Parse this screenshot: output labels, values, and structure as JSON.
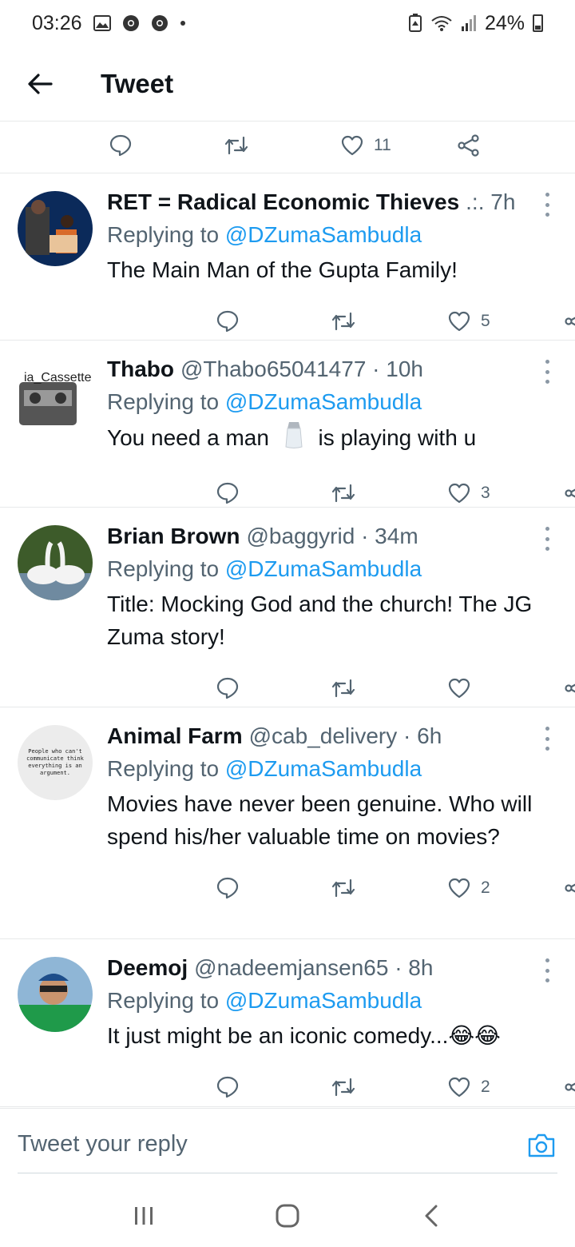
{
  "status_bar": {
    "time": "03:26",
    "battery_percent": "24%",
    "icons": [
      "gallery-icon",
      "chrome-icon",
      "chrome-icon",
      "dot-icon",
      "battery-saver-icon",
      "wifi-icon",
      "signal-icon",
      "battery-icon"
    ]
  },
  "header": {
    "title": "Tweet"
  },
  "top_actions": {
    "likes": "11"
  },
  "replying_label": "Replying to",
  "replying_handle": "@DZumaSambudla",
  "tweets": [
    {
      "name": "RET = Radical Economic Thieves",
      "meta": ".:. 7h",
      "text": "The Main Man of the Gupta Family!",
      "likes": "5"
    },
    {
      "name": "Thabo",
      "meta": "@Thabo65041477 · 10h",
      "text_before": "You need a man",
      "text_after": "is playing with u",
      "avatar_label": "ia_Cassette",
      "likes": "3"
    },
    {
      "name": "Brian Brown",
      "meta": "@baggyrid · 34m",
      "text": "Title: Mocking God and the church! The JG Zuma story!",
      "likes": ""
    },
    {
      "name": "Animal Farm",
      "meta": "@cab_delivery · 6h",
      "text": "Movies have never been genuine. Who will spend his/her valuable time on movies?",
      "avatar_text": "People who can't communicate think everything is an argument.",
      "likes": "2"
    },
    {
      "name": "Deemoj",
      "meta": "@nadeemjansen65 · 8h",
      "text": "It just might be an iconic comedy...😂😂",
      "likes": "2"
    }
  ],
  "reply_bar": {
    "placeholder": "Tweet your reply"
  },
  "colors": {
    "link": "#1d9bf0",
    "muted": "#536471",
    "divider": "#e7e9ea"
  }
}
